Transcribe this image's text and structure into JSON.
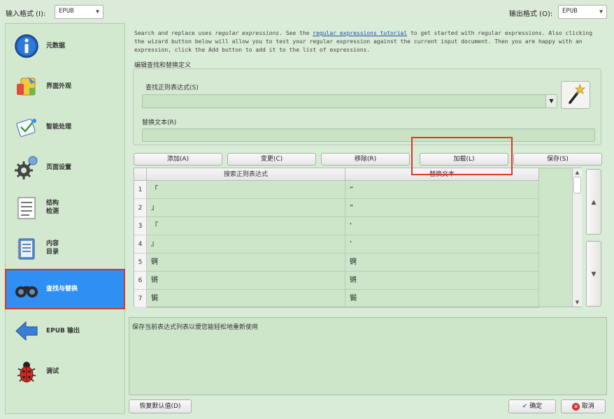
{
  "top": {
    "input_format_label": "输入格式 (I):",
    "input_format_value": "EPUB",
    "output_format_label": "输出格式 (O):",
    "output_format_value": "EPUB"
  },
  "sidebar": {
    "items": [
      {
        "label": "元数据",
        "icon": "info-icon"
      },
      {
        "label": "界面外观",
        "icon": "look-and-feel-icon"
      },
      {
        "label": "智能处理",
        "icon": "heuristic-icon"
      },
      {
        "label": "页面设置",
        "icon": "page-setup-icon"
      },
      {
        "label": "结构\n检测",
        "icon": "structure-icon"
      },
      {
        "label": "内容\n目录",
        "icon": "toc-icon"
      },
      {
        "label": "查找与替换",
        "icon": "binoculars-icon",
        "active": true
      },
      {
        "label": "EPUB 输出",
        "icon": "arrow-left-icon"
      },
      {
        "label": "调试",
        "icon": "bug-icon"
      }
    ]
  },
  "main": {
    "desc_part1": "Search and replace uses ",
    "desc_italic": "regular expressions",
    "desc_part2": ". See the ",
    "desc_link": "regular expressions tutorial",
    "desc_part3": " to get started with regular expressions. Also clicking the wizard button below will allow you to test your regular expression against the current input document. Then you are happy with an expression, click the Add button to add it to the list of expressions.",
    "group_title": "编辑查找和替换定义",
    "regex_label": "查找正则表达式(S)",
    "replace_label": "替换文本(R)",
    "buttons": {
      "add": "添加(A)",
      "change": "变更(C)",
      "remove": "移除(R)",
      "load": "加载(L)",
      "save": "保存(S)"
    },
    "table": {
      "headers": [
        "搜索正则表达式",
        "替换文本"
      ],
      "rows": [
        {
          "num": "1",
          "search": "「",
          "replace": "“"
        },
        {
          "num": "2",
          "search": "」",
          "replace": "”"
        },
        {
          "num": "3",
          "search": "『",
          "replace": "‘"
        },
        {
          "num": "4",
          "search": "』",
          "replace": "’"
        },
        {
          "num": "5",
          "search": "锕",
          "replace": "锕"
        },
        {
          "num": "6",
          "search": "锵",
          "replace": "锵"
        },
        {
          "num": "7",
          "search": "锔",
          "replace": "锔"
        }
      ]
    },
    "help_text": "保存当前表达式列表以便您能轻松地重新使用"
  },
  "footer": {
    "restore_defaults": "恢复默认值(D)",
    "ok": "确定",
    "cancel": "取消"
  },
  "colors": {
    "background": "#d9ecd7",
    "active_item": "#2f8ff3",
    "highlight_red": "#d9372b"
  }
}
